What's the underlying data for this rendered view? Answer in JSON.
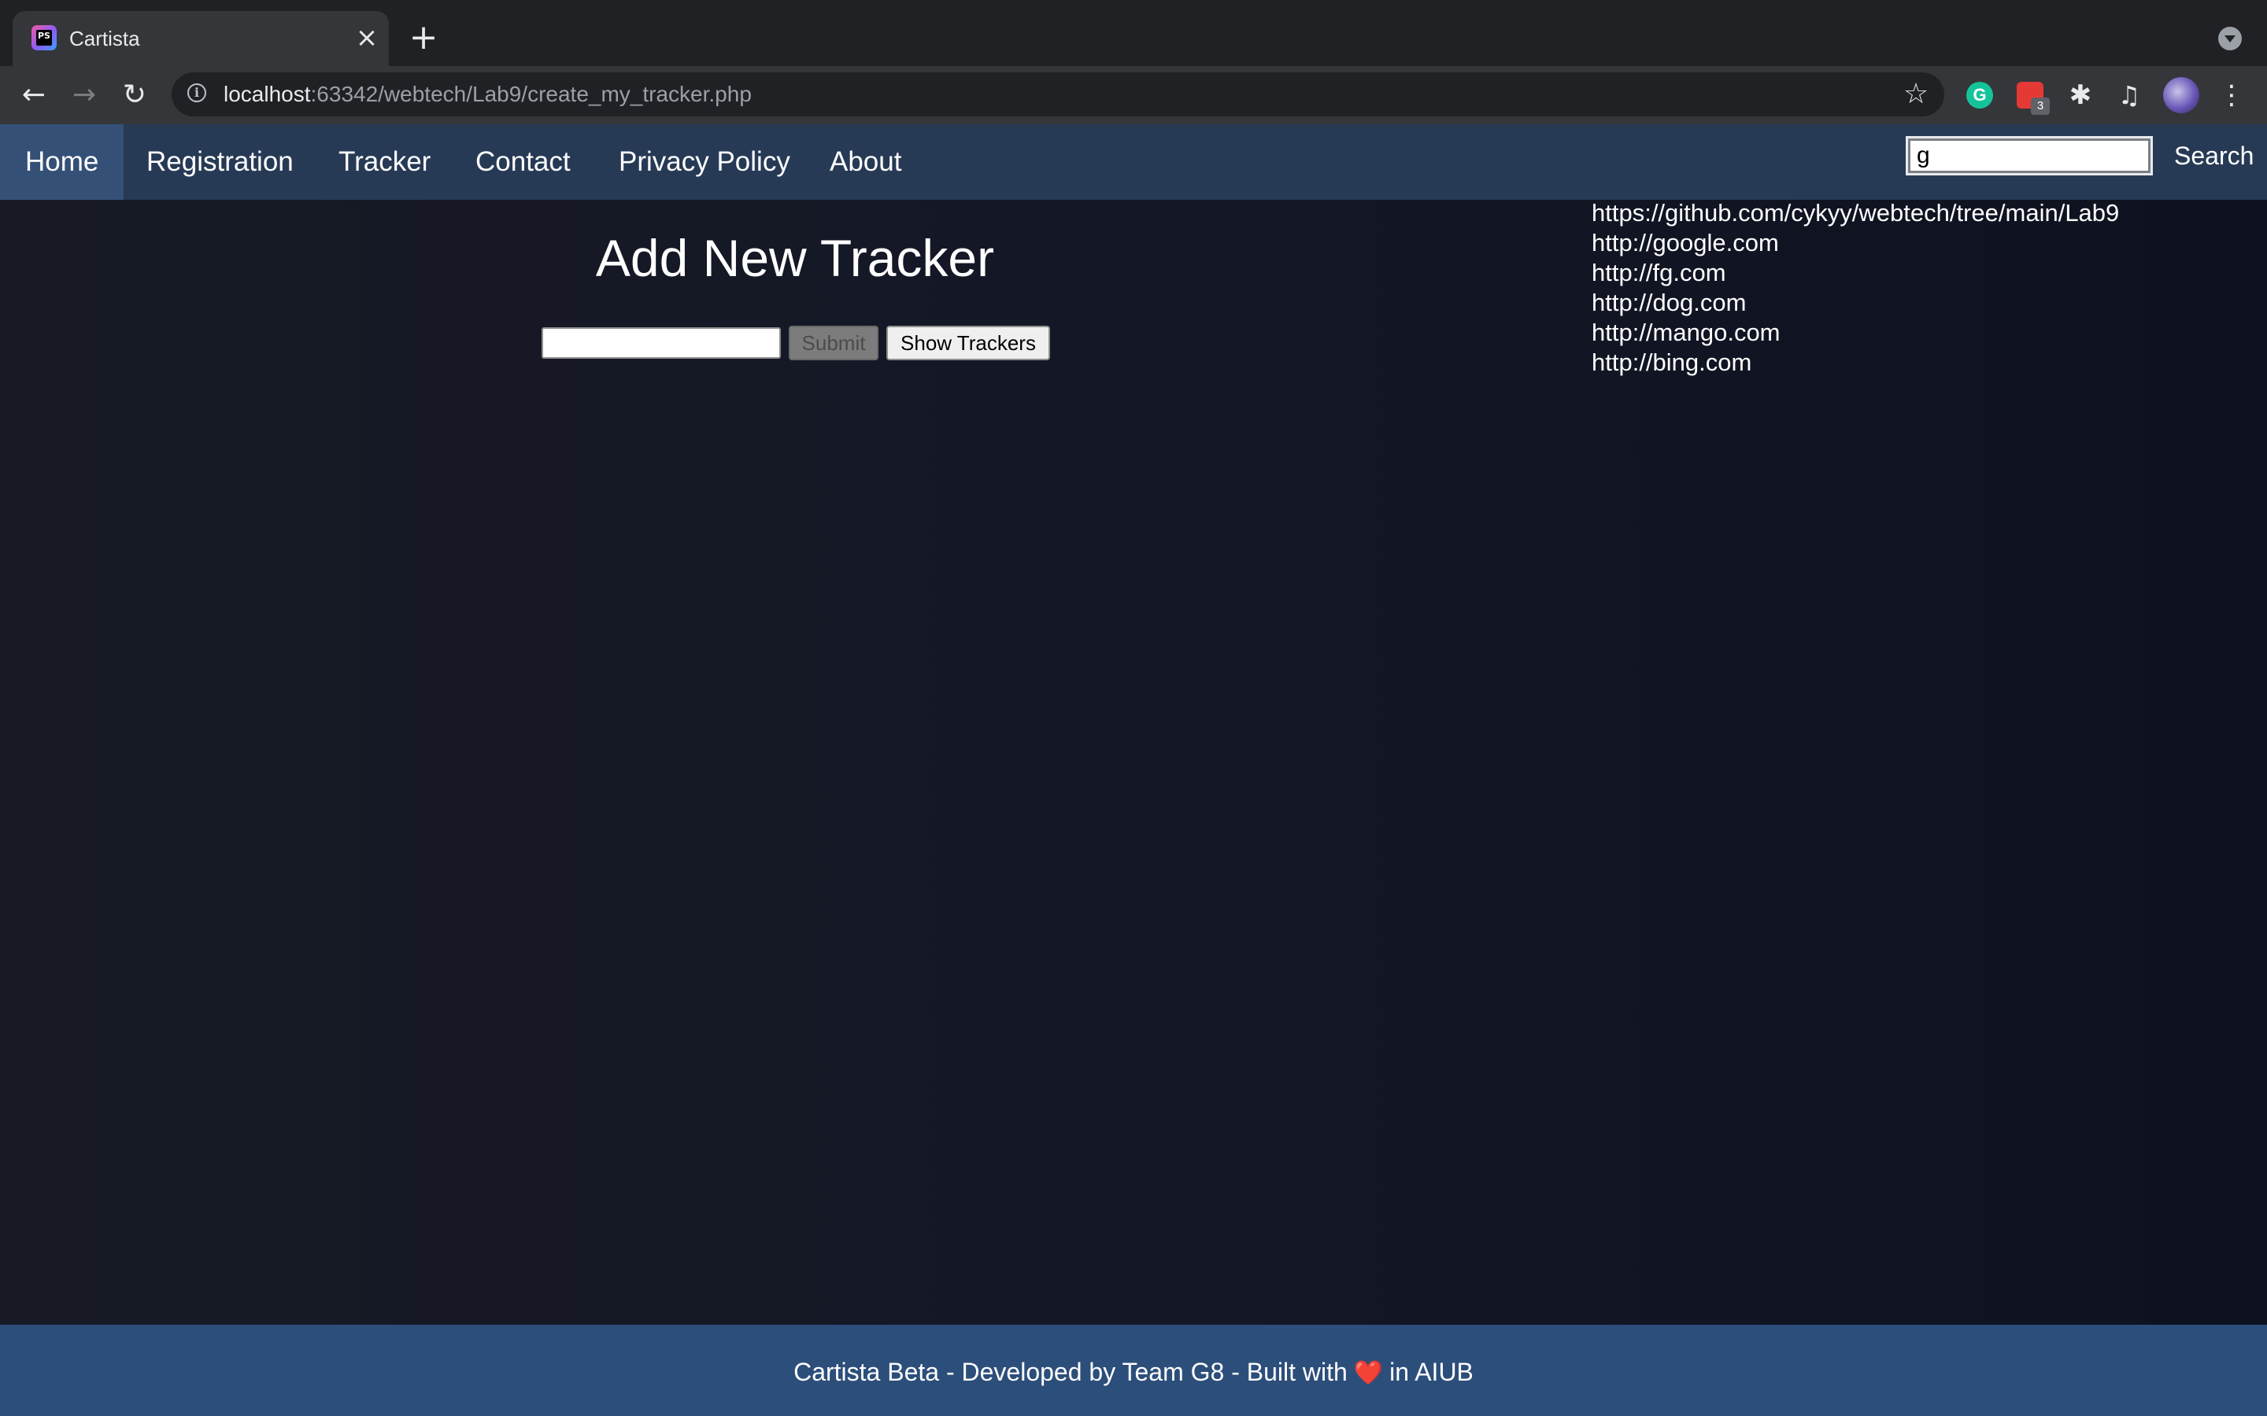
{
  "browser": {
    "tab": {
      "title": "Cartista",
      "favicon_icon": "phpstorm-icon",
      "favicon_text": "PS"
    },
    "address": {
      "host": "localhost",
      "path": ":63342/webtech/Lab9/create_my_tracker.php"
    },
    "icons": {
      "back": "back-arrow-icon",
      "forward": "forward-arrow-icon",
      "reload": "reload-icon",
      "info": "info-icon",
      "bookmark": "star-icon",
      "grammarly": "grammarly-icon",
      "todo_ext": "todo-extension-icon",
      "extensions": "puzzle-icon",
      "media": "media-control-icon",
      "menu": "more-vertical-icon"
    },
    "grammarly_letter": "G",
    "todo_badge": "3"
  },
  "site": {
    "nav": {
      "items": [
        {
          "label": "Home",
          "active": true
        },
        {
          "label": "Registration"
        },
        {
          "label": "Tracker"
        },
        {
          "label": "Contact"
        },
        {
          "label": "Privacy Policy"
        },
        {
          "label": "About"
        }
      ]
    },
    "search": {
      "value": "g",
      "label": "Search"
    },
    "results": [
      "https://github.com/cykyy/webtech/tree/main/Lab9",
      "http://google.com",
      "http://fg.com",
      "http://dog.com",
      "http://mango.com",
      "http://bing.com"
    ],
    "main": {
      "heading": "Add New Tracker",
      "input_value": "",
      "submit_label": "Submit",
      "show_label": "Show Trackers"
    },
    "footer": {
      "text_before": "Cartista Beta - Developed by Team G8 - Built with",
      "heart": "❤️",
      "text_after": "in AIUB"
    }
  },
  "colors": {
    "nav_bg": "#273a55",
    "nav_active_bg": "#355077",
    "footer_bg": "#2c4e7a",
    "page_bg": "#141826"
  }
}
